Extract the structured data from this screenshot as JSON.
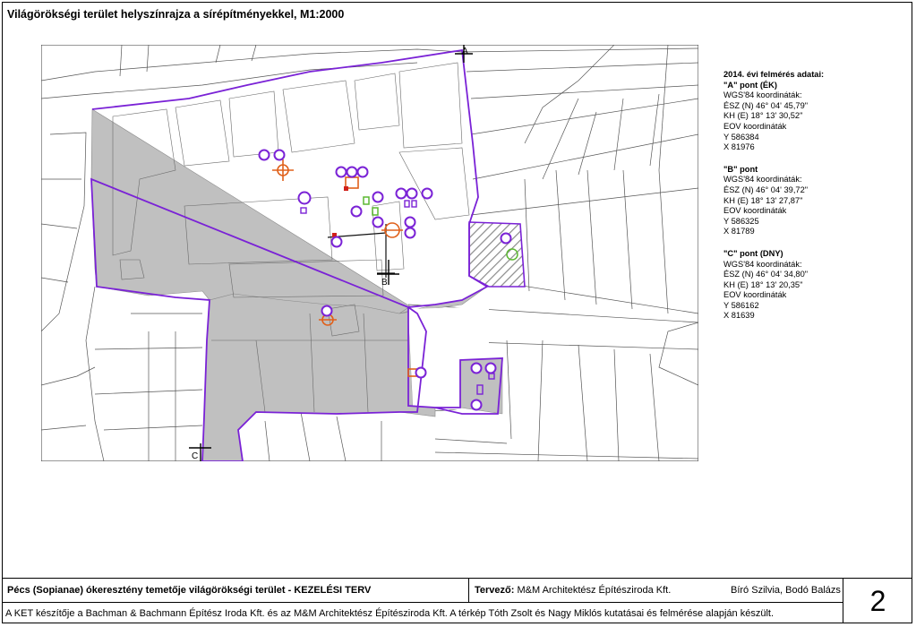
{
  "title": "Világörökségi terület helyszínrajza a sírépítményekkel, M1:2000",
  "survey": {
    "heading": "2014. évi felmérés adatai:",
    "points": [
      {
        "name": "\"A\" pont (ÉK)",
        "wgs_label": "WGS'84 koordináták:",
        "n": "ÉSZ (N) 46° 04' 45,79\"",
        "e": "KH (E) 18° 13' 30,52\"",
        "eov_label": "EOV koordináták",
        "y": "Y 586384",
        "x": "X 81976"
      },
      {
        "name": "\"B\" pont",
        "wgs_label": "WGS'84 koordináták:",
        "n": "ÉSZ (N) 46° 04' 39,72\"",
        "e": "KH (E) 18° 13' 27,87\"",
        "eov_label": "EOV koordináták",
        "y": "Y 586325",
        "x": "X 81789"
      },
      {
        "name": "\"C\" pont (DNY)",
        "wgs_label": "WGS'84 koordináták:",
        "n": "ÉSZ (N) 46° 04' 34,80\"",
        "e": "KH (E) 18° 13' 20,35\"",
        "eov_label": "EOV koordináták",
        "y": "Y 586162",
        "x": "X 81639"
      }
    ]
  },
  "map": {
    "point_labels": [
      "A",
      "B",
      "C"
    ],
    "colors": {
      "heritage_area": "#c0c0c0",
      "boundary": "#7a22d6",
      "tomb_orange": "#e0601a",
      "tomb_green": "#5cb832",
      "hatch": "#888888"
    }
  },
  "footer": {
    "project": "Pécs (Sopianae) ókeresztény temetője világörökségi terület - KEZELÉSI TERV",
    "designer_label": "Tervező:",
    "designer": "M&M Architektész Építésziroda Kft.",
    "authors": "Bíró Szilvia, Bodó Balázs",
    "credit": "A KET készítője a Bachman & Bachmann Építész Iroda Kft. és az M&M Architektész Építésziroda Kft. A térkép Tóth Zsolt és Nagy Miklós kutatásai és felmérése alapján készült.",
    "page_number": "2"
  }
}
